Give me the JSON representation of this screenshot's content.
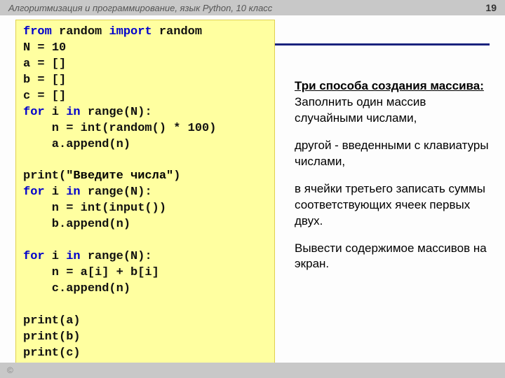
{
  "header": {
    "title": "Алгоритмизация и программирование, язык Python, 10 класс",
    "page": "19"
  },
  "code": {
    "lines": [
      [
        {
          "t": "from",
          "c": "kw"
        },
        {
          "t": " random ",
          "c": ""
        },
        {
          "t": "import",
          "c": "kw"
        },
        {
          "t": " random",
          "c": ""
        }
      ],
      [
        {
          "t": "N = ",
          "c": ""
        },
        {
          "t": "10",
          "c": ""
        }
      ],
      [
        {
          "t": "a = []",
          "c": ""
        }
      ],
      [
        {
          "t": "b = []",
          "c": ""
        }
      ],
      [
        {
          "t": "c = []",
          "c": ""
        }
      ],
      [
        {
          "t": "for",
          "c": "kw"
        },
        {
          "t": " i ",
          "c": ""
        },
        {
          "t": "in",
          "c": "kw"
        },
        {
          "t": " range(N):",
          "c": ""
        }
      ],
      [
        {
          "t": "    n = int(random() * ",
          "c": ""
        },
        {
          "t": "100",
          "c": ""
        },
        {
          "t": ")",
          "c": ""
        }
      ],
      [
        {
          "t": "    a.append(n)",
          "c": ""
        }
      ],
      [
        {
          "t": "",
          "c": ""
        }
      ],
      [
        {
          "t": "print(",
          "c": ""
        },
        {
          "t": "\"Введите числа\"",
          "c": "str"
        },
        {
          "t": ")",
          "c": ""
        }
      ],
      [
        {
          "t": "for",
          "c": "kw"
        },
        {
          "t": " i ",
          "c": ""
        },
        {
          "t": "in",
          "c": "kw"
        },
        {
          "t": " range(N):",
          "c": ""
        }
      ],
      [
        {
          "t": "    n = int(input())",
          "c": ""
        }
      ],
      [
        {
          "t": "    b.append(n)",
          "c": ""
        }
      ],
      [
        {
          "t": "",
          "c": ""
        }
      ],
      [
        {
          "t": "for",
          "c": "kw"
        },
        {
          "t": " i ",
          "c": ""
        },
        {
          "t": "in",
          "c": "kw"
        },
        {
          "t": " range(N):",
          "c": ""
        }
      ],
      [
        {
          "t": "    n = a[i] + b[i]",
          "c": ""
        }
      ],
      [
        {
          "t": "    c.append(n)",
          "c": ""
        }
      ],
      [
        {
          "t": "",
          "c": ""
        }
      ],
      [
        {
          "t": "print(a)",
          "c": ""
        }
      ],
      [
        {
          "t": "print(b)",
          "c": ""
        }
      ],
      [
        {
          "t": "print(c)",
          "c": ""
        }
      ]
    ]
  },
  "explain": {
    "heading": "Три способа создания массива:",
    "p1": "Заполнить один массив случайными числами,",
    "p2": "другой - введенными с клавиатуры числами,",
    "p3": "в ячейки третьего записать суммы соответствующих ячеек первых двух.",
    "p4": "Вывести содержимое массивов на экран."
  },
  "footer": {
    "copyright": "©"
  }
}
